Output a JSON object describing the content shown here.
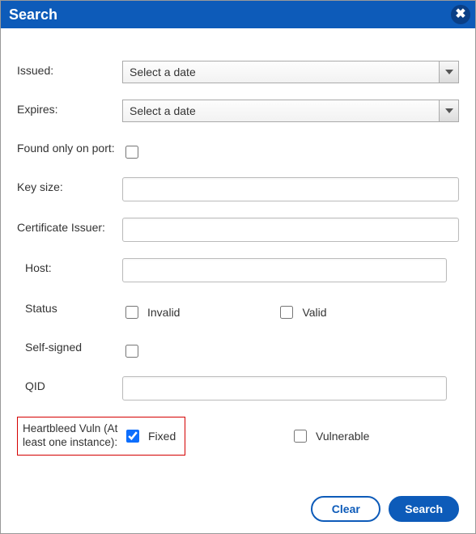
{
  "titlebar": {
    "title": "Search"
  },
  "form": {
    "issued": {
      "label": "Issued:",
      "placeholder": "Select a date",
      "value": ""
    },
    "expires": {
      "label": "Expires:",
      "placeholder": "Select a date",
      "value": ""
    },
    "found_on_port": {
      "label": "Found only on port:",
      "checked": false
    },
    "key_size": {
      "label": "Key size:",
      "value": ""
    },
    "cert_issuer": {
      "label": "Certificate Issuer:",
      "value": ""
    },
    "host": {
      "label": "Host:",
      "value": ""
    },
    "status": {
      "label": "Status",
      "invalid": {
        "label": "Invalid",
        "checked": false
      },
      "valid": {
        "label": "Valid",
        "checked": false
      }
    },
    "self_signed": {
      "label": "Self-signed",
      "checked": false
    },
    "qid": {
      "label": "QID",
      "value": ""
    },
    "heartbleed": {
      "label": "Heartbleed Vuln (At least one instance):",
      "fixed": {
        "label": "Fixed",
        "checked": true
      },
      "vulnerable": {
        "label": "Vulnerable",
        "checked": false
      }
    }
  },
  "buttons": {
    "clear": "Clear",
    "search": "Search"
  }
}
